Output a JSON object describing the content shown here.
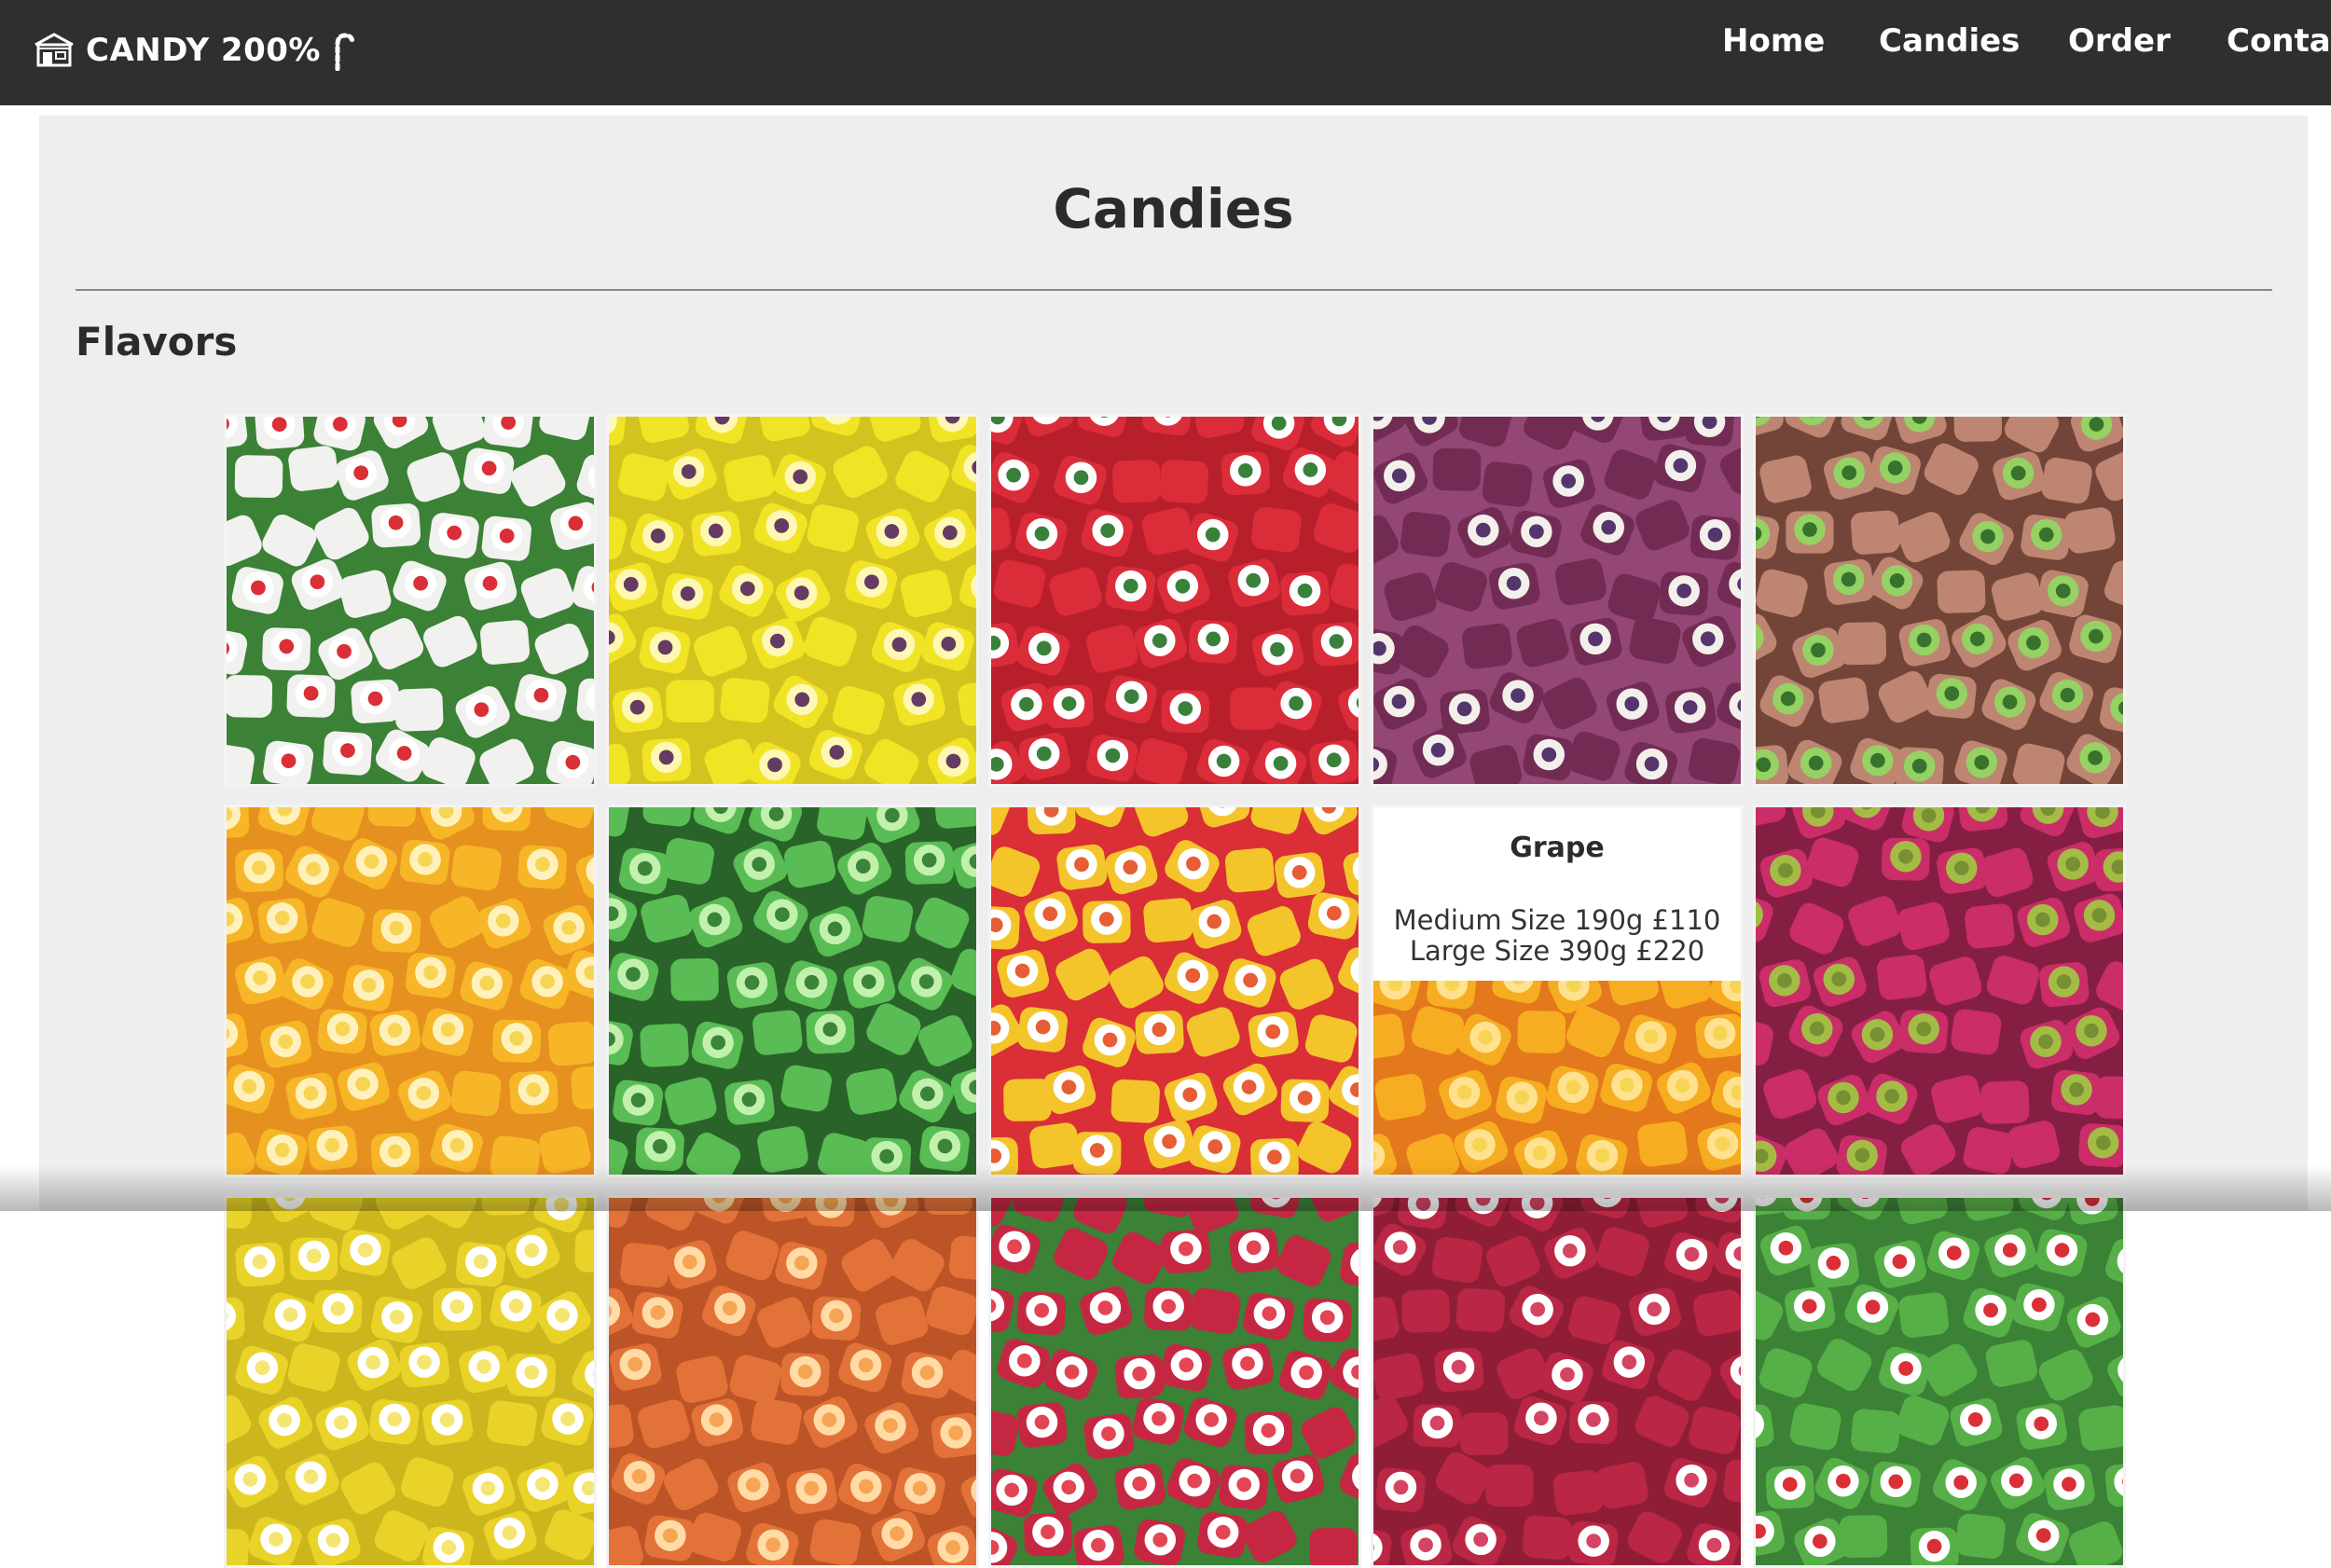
{
  "brand": {
    "name": "CANDY 200%",
    "icon": "candy-shop-icon",
    "decor_icon": "candy-cane-icon"
  },
  "nav": [
    {
      "label": "Home"
    },
    {
      "label": "Candies"
    },
    {
      "label": "Order"
    },
    {
      "label": "Contac"
    }
  ],
  "page": {
    "title": "Candies",
    "section_title": "Flavors"
  },
  "colors": {
    "topbar": "#2f2f2f",
    "panel": "#eeeeee",
    "text": "#2b2b2b"
  },
  "tiles": [
    {
      "image": "cherry candy photo",
      "base": "#f1f1ee",
      "dot": "#d8232a",
      "ring": "#ffffff",
      "leaf": "#2f7a2a"
    },
    {
      "image": "banana candy photo",
      "base": "#f1e318",
      "dot": "#5a2f5a",
      "ring": "#fff7b0",
      "leaf": "#d2c010"
    },
    {
      "image": "watermelon candy photo",
      "base": "#d91f2e",
      "dot": "#2d7a2e",
      "ring": "#ffffff",
      "leaf": "#b3111e"
    },
    {
      "image": "grape candy photo",
      "base": "#6a1f4a",
      "dot": "#4b2a63",
      "ring": "#f3f0ea",
      "leaf": "#8e3b6c"
    },
    {
      "image": "kiwi candy photo",
      "base": "#b97e6a",
      "dot": "#2b6b1f",
      "ring": "#8fcf5a",
      "leaf": "#6a3a2c"
    },
    {
      "image": "orange candy photo",
      "base": "#f6b21a",
      "dot": "#f7d34a",
      "ring": "#fff1b8",
      "leaf": "#e58a12"
    },
    {
      "image": "lime candy photo",
      "base": "#4fb84a",
      "dot": "#2f7d2d",
      "ring": "#bff0a8",
      "leaf": "#1c5a1c"
    },
    {
      "image": "tutti-frutti candy photo",
      "base": "#f4c21e",
      "dot": "#e5532a",
      "ring": "#ffffff",
      "leaf": "#d8232a"
    },
    {
      "image": "orange slices candy photo",
      "base": "#f6a814",
      "dot": "#f7d34a",
      "ring": "#ffe08a",
      "leaf": "#e2700e",
      "hover": {
        "name": "Grape",
        "line1": "Medium Size 190g £110",
        "line2": "Large Size 390g £220"
      }
    },
    {
      "image": "passion fruit candy photo",
      "base": "#c7205e",
      "dot": "#6f8a25",
      "ring": "#9fb83a",
      "leaf": "#7d1238"
    },
    {
      "image": "lemon candy photo",
      "base": "#e8d11c",
      "dot": "#f5e46a",
      "ring": "#ffffff",
      "leaf": "#c9b20f"
    },
    {
      "image": "peach candy photo",
      "base": "#e26a2c",
      "dot": "#f5a04a",
      "ring": "#ffd9a0",
      "leaf": "#b84a1a"
    },
    {
      "image": "strawberry candy photo",
      "base": "#c21a38",
      "dot": "#e23a4a",
      "ring": "#ffffff",
      "leaf": "#2f7a2a"
    },
    {
      "image": "raspberry candy photo",
      "base": "#b51a3a",
      "dot": "#d23a5a",
      "ring": "#ffffff",
      "leaf": "#8a0f2a"
    },
    {
      "image": "apple candy photo",
      "base": "#4caa3c",
      "dot": "#d8232a",
      "ring": "#ffffff",
      "leaf": "#2f7a2a"
    }
  ]
}
